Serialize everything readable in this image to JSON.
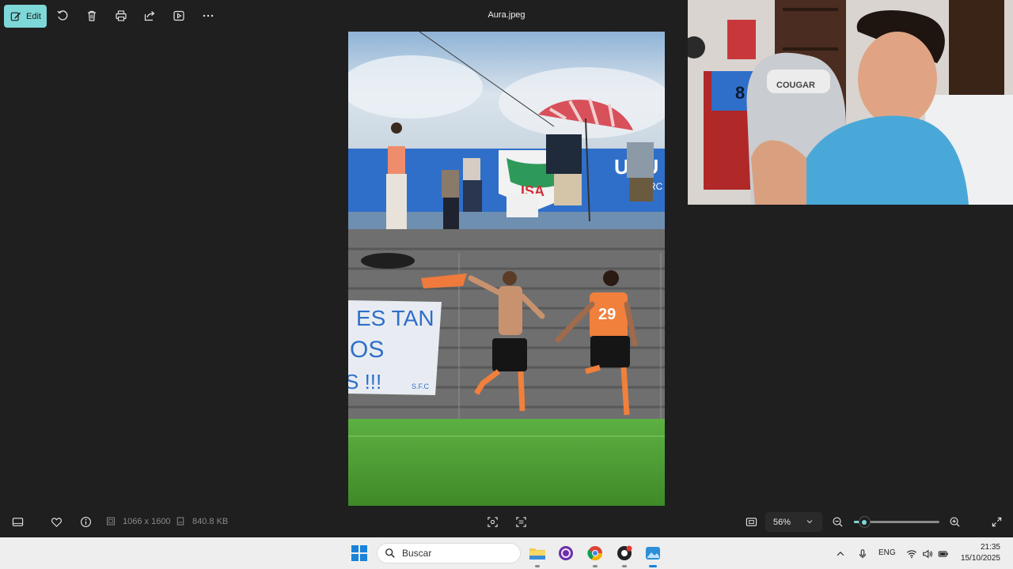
{
  "window": {
    "title": "Aura.jpeg"
  },
  "toolbar": {
    "edit_label": "Edit",
    "icons": [
      "edit-icon",
      "rotate-icon",
      "delete-icon",
      "print-icon",
      "share-icon",
      "slideshow-icon",
      "more-icon"
    ]
  },
  "photo": {
    "banner_text_line1": "ES TAN",
    "banner_text_line2": "OS",
    "banner_text_line3": "S !!!",
    "banner_signature": "S.F.C",
    "sign_text": "URU",
    "sign_text2": "RC",
    "sponsor_text": "ISA",
    "jersey_number": "29",
    "colors": {
      "sky": "#a8c0d8",
      "grass": "#4c9a33",
      "stands": "#6f6f6f",
      "banner": "#2f6fc9",
      "jersey": "#f0803c"
    }
  },
  "webcam": {
    "chair_text": "COUGAR",
    "shirt_number": "8"
  },
  "bottombar": {
    "dimensions": "1066 x 1600",
    "file_size": "840.8 KB",
    "zoom_label": "56%",
    "zoom_level_percent": 56,
    "slider_fraction": 0.12
  },
  "taskbar": {
    "search_placeholder": "Buscar",
    "language": "ENG",
    "time": "21:35",
    "date": "15/10/2025"
  },
  "theme": {
    "accent": "#7fd8d8",
    "background": "#1f1f1f",
    "taskbar": "#eeeeee"
  }
}
